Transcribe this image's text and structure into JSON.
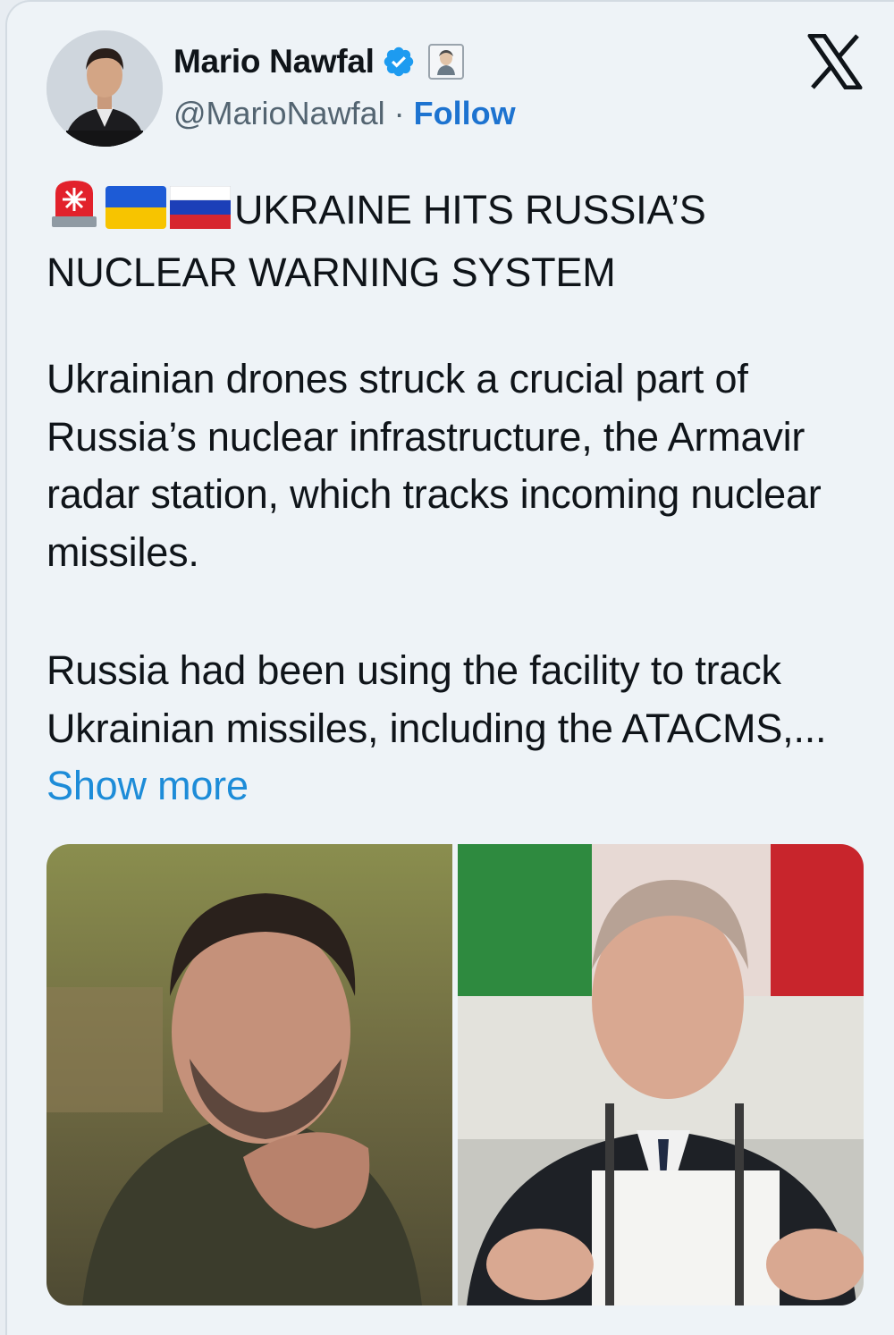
{
  "author": {
    "name": "Mario Nawfal",
    "handle": "@MarioNawfal",
    "separator": " · ",
    "follow_label": "Follow"
  },
  "icons": {
    "verified": "verified-badge-icon",
    "label": "automated-account-label-icon",
    "platform": "x-logo-icon",
    "emoji": [
      "rotating-light-emoji",
      "ukraine-flag-emoji",
      "russia-flag-emoji"
    ]
  },
  "post": {
    "headline_line1": "UKRAINE HITS RUSSIA’S",
    "headline_line2": "NUCLEAR WARNING SYSTEM",
    "paragraph1": "Ukrainian drones struck a crucial part of Russia’s nuclear infrastructure, the Armavir radar station, which tracks incoming nuclear missiles.",
    "paragraph2": "Russia had been using the facility to track Ukrainian missiles, including the ATACMS,...",
    "show_more_label": "Show more"
  },
  "media": [
    {
      "alt": "photo-left"
    },
    {
      "alt": "photo-right"
    }
  ],
  "colors": {
    "background": "#eef3f7",
    "link": "#1d8cd8",
    "follow": "#1d73d0",
    "verified": "#1d9bf0",
    "secondary_text": "#536471"
  }
}
